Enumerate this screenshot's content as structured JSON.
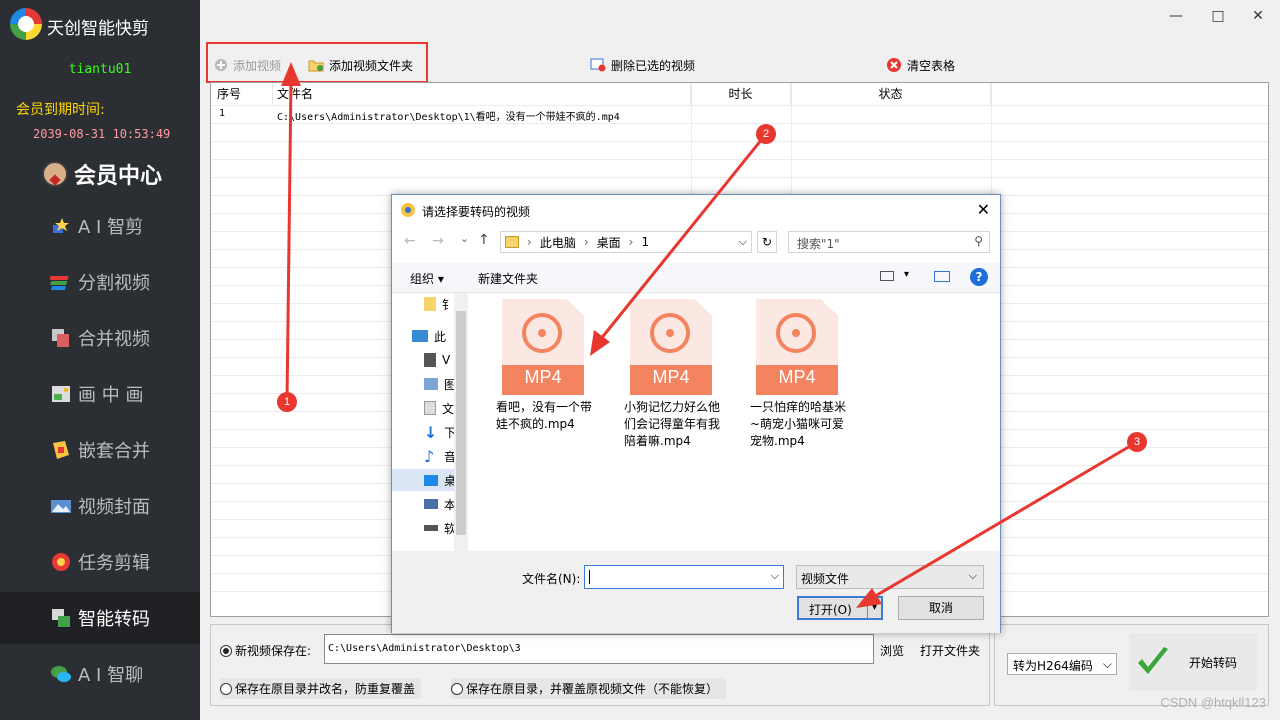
{
  "app": {
    "title": "天创智能快剪",
    "username": "tiantu01",
    "expire_label": "会员到期时间:",
    "expire_time": "2039-08-31 10:53:49",
    "member_center": "会员中心"
  },
  "nav": [
    {
      "label": "A I 智剪",
      "icon": "ai-cut-icon"
    },
    {
      "label": "分割视频",
      "icon": "split-video-icon"
    },
    {
      "label": "合并视频",
      "icon": "merge-video-icon"
    },
    {
      "label": "画 中 画",
      "icon": "pip-icon"
    },
    {
      "label": "嵌套合并",
      "icon": "nested-merge-icon"
    },
    {
      "label": "视频封面",
      "icon": "video-cover-icon"
    },
    {
      "label": "任务剪辑",
      "icon": "task-edit-icon"
    },
    {
      "label": "智能转码",
      "icon": "smart-transcode-icon",
      "active": true
    },
    {
      "label": "A I 智聊",
      "icon": "ai-chat-icon"
    }
  ],
  "window": {
    "minimize": "—",
    "maximize": "□",
    "close": "✕"
  },
  "toolbar": {
    "add_video": "添加视频",
    "add_folder": "添加视频文件夹",
    "delete_selected": "删除已选的视频",
    "clear_table": "清空表格"
  },
  "table": {
    "headers": [
      "序号",
      "文件名",
      "时长",
      "状态"
    ],
    "rows": [
      {
        "index": "1",
        "filename": "C:\\Users\\Administrator\\Desktop\\1\\看吧，没有一个带娃不疯的.mp4"
      }
    ]
  },
  "bottom": {
    "new_save_label": "新视频保存在:",
    "save_path": "C:\\Users\\Administrator\\Desktop\\3",
    "browse": "浏览",
    "open_folder": "打开文件夹",
    "option_rename": "保存在原目录并改名，防重复覆盖",
    "option_overwrite": "保存在原目录，并覆盖原视频文件（不能恢复）",
    "encode": "转为H264编码",
    "start": "开始转码"
  },
  "dialog": {
    "title": "请选择要转码的视频",
    "breadcrumb": [
      "此电脑",
      "桌面",
      "1"
    ],
    "search_placeholder": "搜索\"1\"",
    "organize": "组织 ▾",
    "new_folder": "新建文件夹",
    "tree": [
      "钅",
      "此",
      "V",
      "图",
      "文",
      "下",
      "音",
      "桌",
      "本",
      "软"
    ],
    "files": [
      {
        "ext": "MP4",
        "name": "看吧，没有一个带娃不疯的.mp4"
      },
      {
        "ext": "MP4",
        "name": "小狗记忆力好么他们会记得童年有我陪着嘛.mp4"
      },
      {
        "ext": "MP4",
        "name": "一只怕痒的哈基米~萌宠小猫咪可爱宠物.mp4"
      }
    ],
    "filename_label": "文件名(N):",
    "filetype": "视频文件",
    "open": "打开(O)",
    "cancel": "取消"
  },
  "annotations": [
    "1",
    "2",
    "3"
  ],
  "watermark": "CSDN @htqkll123",
  "colors": {
    "sidebar_bg": "#2b2f33",
    "accent_red": "#e8372f",
    "file_orange": "#f4845f",
    "username_green": "#39ff14",
    "expire_yellow": "#ffd700"
  }
}
